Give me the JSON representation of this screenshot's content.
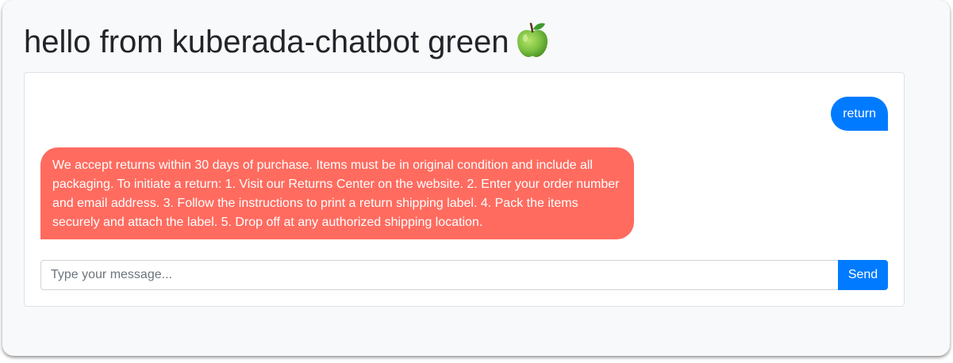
{
  "header": {
    "title": "hello from kuberada-chatbot green",
    "title_icon": "green-apple-icon"
  },
  "chat": {
    "messages": [
      {
        "role": "user",
        "text": "return"
      },
      {
        "role": "bot",
        "text": "We accept returns within 30 days of purchase. Items must be in original condition and include all packaging. To initiate a return: 1. Visit our Returns Center on the website. 2. Enter your order number and email address. 3. Follow the instructions to print a return shipping label. 4. Pack the items securely and attach the label. 5. Drop off at any authorized shipping location."
      }
    ]
  },
  "composer": {
    "placeholder": "Type your message...",
    "value": "",
    "send_label": "Send"
  },
  "colors": {
    "user_bubble": "#007bff",
    "bot_bubble": "#ff6b5f",
    "send_button": "#007bff",
    "background": "#f8f9fa"
  }
}
